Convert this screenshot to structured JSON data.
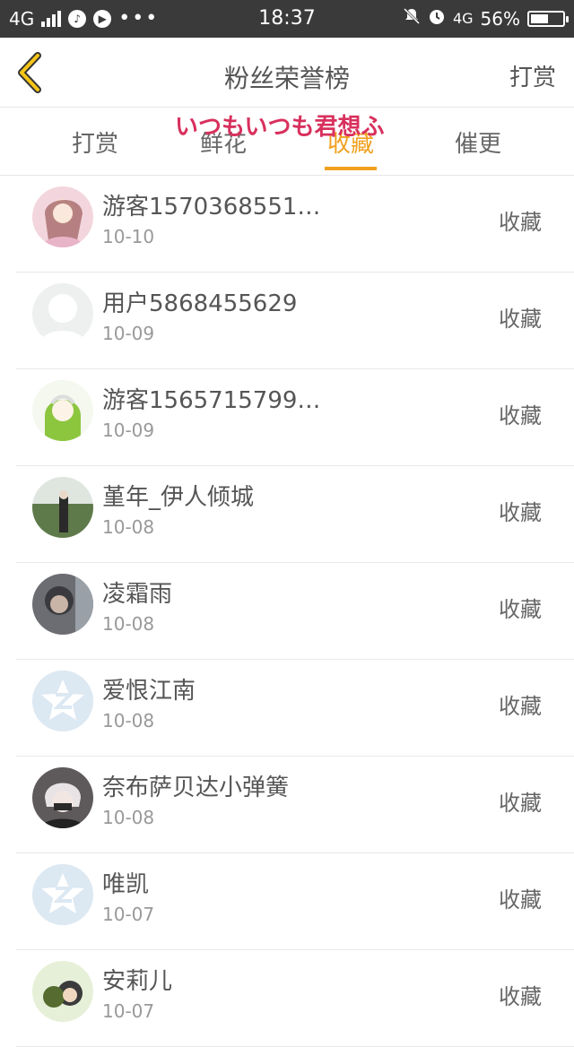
{
  "status_bar": {
    "network": "4G",
    "time": "18:37",
    "network_right": "4G",
    "battery_level": 0.56,
    "battery": "56%"
  },
  "navbar": {
    "title": "粉丝荣誉榜",
    "action": "打赏"
  },
  "tabs": [
    {
      "label": "打赏"
    },
    {
      "label": "鲜花"
    },
    {
      "label": "收藏"
    },
    {
      "label": "催更"
    }
  ],
  "active_tab": "收藏",
  "watermark": "いつもいつも君想ふ",
  "accent_color": "#f0a01e",
  "rows": [
    {
      "name": "游客1570368551…",
      "date": "10-10",
      "action": "收藏",
      "avatar": "anime-girl-avatar"
    },
    {
      "name": "用户5868455629",
      "date": "10-09",
      "action": "收藏",
      "avatar": "default-person-avatar"
    },
    {
      "name": "游客1565715799…",
      "date": "10-09",
      "action": "收藏",
      "avatar": "green-hood-avatar"
    },
    {
      "name": "堇年_伊人倾城",
      "date": "10-08",
      "action": "收藏",
      "avatar": "photo-field-avatar"
    },
    {
      "name": "凌霜雨",
      "date": "10-08",
      "action": "收藏",
      "avatar": "dark-photo-avatar"
    },
    {
      "name": "爱恨江南",
      "date": "10-08",
      "action": "收藏",
      "avatar": "qq-star-avatar"
    },
    {
      "name": "奈布萨贝达小弹簧",
      "date": "10-08",
      "action": "收藏",
      "avatar": "masked-boy-avatar"
    },
    {
      "name": "唯凯",
      "date": "10-07",
      "action": "收藏",
      "avatar": "qq-star-avatar"
    },
    {
      "name": "安莉儿",
      "date": "10-07",
      "action": "收藏",
      "avatar": "cartoon-avatar"
    }
  ]
}
